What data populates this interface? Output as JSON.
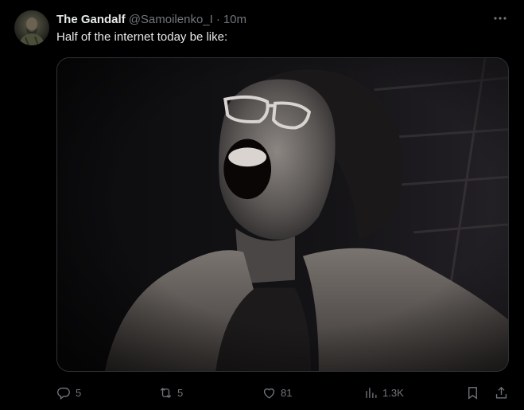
{
  "author": {
    "display_name": "The Gandalf",
    "handle": "@Samoilenko_I",
    "separator": "·",
    "time": "10m"
  },
  "tweet": {
    "text": "Half of the internet today be like:"
  },
  "actions": {
    "replies": "5",
    "reposts": "5",
    "likes": "81",
    "views": "1.3K"
  },
  "icons": {
    "more": "more-horizontal-icon",
    "reply": "reply-icon",
    "repost": "repost-icon",
    "like": "heart-icon",
    "views": "views-chart-icon",
    "bookmark": "bookmark-icon",
    "share": "share-icon"
  },
  "colors": {
    "background": "#000000",
    "primary_text": "#e7e9ea",
    "secondary_text": "#71767b",
    "border": "#2f3336"
  }
}
